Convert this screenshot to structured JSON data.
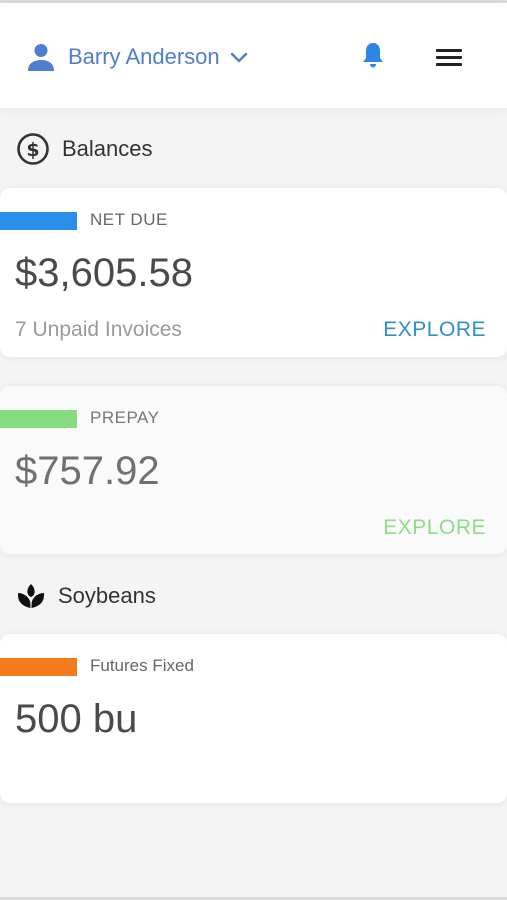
{
  "header": {
    "user_name": "Barry Anderson",
    "icons": {
      "user": "person-icon",
      "dropdown": "chevron-down-icon",
      "notifications": "bell-icon",
      "menu": "hamburger-menu-icon"
    },
    "accent_color": "#4f7ecf",
    "bell_color": "#2d86e6"
  },
  "sections": {
    "balances": {
      "title": "Balances",
      "icon": "dollar-circle-icon"
    },
    "soybeans": {
      "title": "Soybeans",
      "icon": "sprout-icon"
    }
  },
  "cards": {
    "net_due": {
      "label": "NET DUE",
      "amount": "$3,605.58",
      "subtitle": "7 Unpaid Invoices",
      "action": "EXPLORE",
      "stripe_color": "#2b8eea",
      "action_color": "#2f8fc8"
    },
    "prepay": {
      "label": "PREPAY",
      "amount": "$757.92",
      "action": "EXPLORE",
      "stripe_color": "#86dc7e",
      "action_color": "#8ddc86"
    },
    "futures_fixed": {
      "label": "Futures Fixed",
      "amount": "500 bu",
      "stripe_color": "#f47b1c"
    }
  }
}
